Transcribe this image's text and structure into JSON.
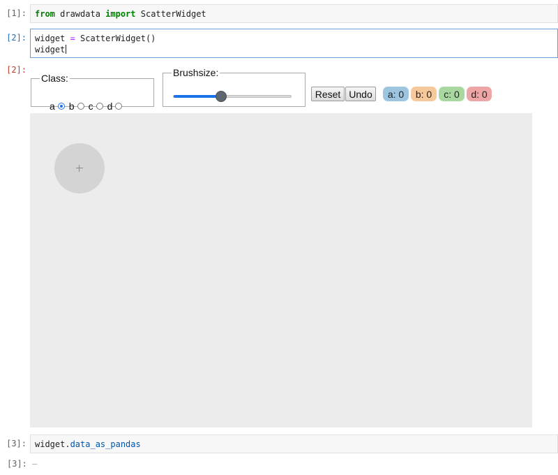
{
  "cells": [
    {
      "prompt": "[1]:",
      "code": {
        "kw1": "from",
        "mod": " drawdata ",
        "kw2": "import",
        "name": " ScatterWidget"
      }
    },
    {
      "prompt": "[2]:",
      "line1": {
        "lhs": "widget ",
        "op": "=",
        "rhs": " ScatterWidget()"
      },
      "line2": "widget"
    },
    {
      "prompt": "[3]:",
      "code": {
        "obj": "widget.",
        "attr": "data_as_pandas"
      }
    },
    {
      "prompt": "[3]:",
      "placeholder": "—"
    }
  ],
  "output": {
    "prompt": "[2]:"
  },
  "widget": {
    "class_legend": "Class:",
    "classes": [
      {
        "label": "a",
        "checked": true
      },
      {
        "label": "b",
        "checked": false
      },
      {
        "label": "c",
        "checked": false
      },
      {
        "label": "d",
        "checked": false
      }
    ],
    "brush_legend": "Brushsize:",
    "brush_value_fraction": 0.4,
    "reset_label": "Reset",
    "undo_label": "Undo",
    "counts": [
      {
        "label": "a: 0",
        "color": "#9ec5e0"
      },
      {
        "label": "b: 0",
        "color": "#f7c99a"
      },
      {
        "label": "c: 0",
        "color": "#a8d8a0"
      },
      {
        "label": "d: 0",
        "color": "#eda5a5"
      }
    ],
    "canvas_color": "#ececec"
  }
}
